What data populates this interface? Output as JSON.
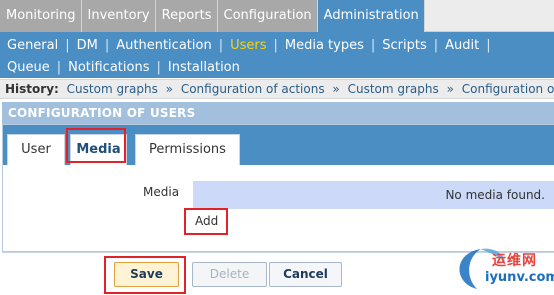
{
  "top_menu": {
    "items": [
      {
        "label": "Monitoring",
        "active": false
      },
      {
        "label": "Inventory",
        "active": false
      },
      {
        "label": "Reports",
        "active": false
      },
      {
        "label": "Configuration",
        "active": false
      },
      {
        "label": "Administration",
        "active": true
      }
    ]
  },
  "sub_menu": {
    "row1": [
      "General",
      "DM",
      "Authentication",
      "Users",
      "Media types",
      "Scripts",
      "Audit"
    ],
    "row2": [
      "Queue",
      "Notifications",
      "Installation"
    ],
    "active": "Users"
  },
  "history": {
    "label": "History:",
    "crumbs": [
      "Custom graphs",
      "Configuration of actions",
      "Custom graphs",
      "Configuration of u"
    ],
    "separator": "»"
  },
  "header": {
    "title": "CONFIGURATION OF USERS"
  },
  "tabs": {
    "user": "User",
    "media": "Media",
    "permissions": "Permissions",
    "active": "Media"
  },
  "form": {
    "media_label": "Media",
    "media_empty": "No media found.",
    "add_link": "Add"
  },
  "buttons": {
    "save": "Save",
    "delete": "Delete",
    "cancel": "Cancel"
  },
  "watermark": {
    "line1": "运维网",
    "line2": "iyunv.com"
  },
  "colors": {
    "accent": "#4a8ec4",
    "active_submenu": "#ffd400",
    "highlight": "#e0232a",
    "header_bg": "#a2c0dd",
    "media_box": "#ccd9f8"
  }
}
